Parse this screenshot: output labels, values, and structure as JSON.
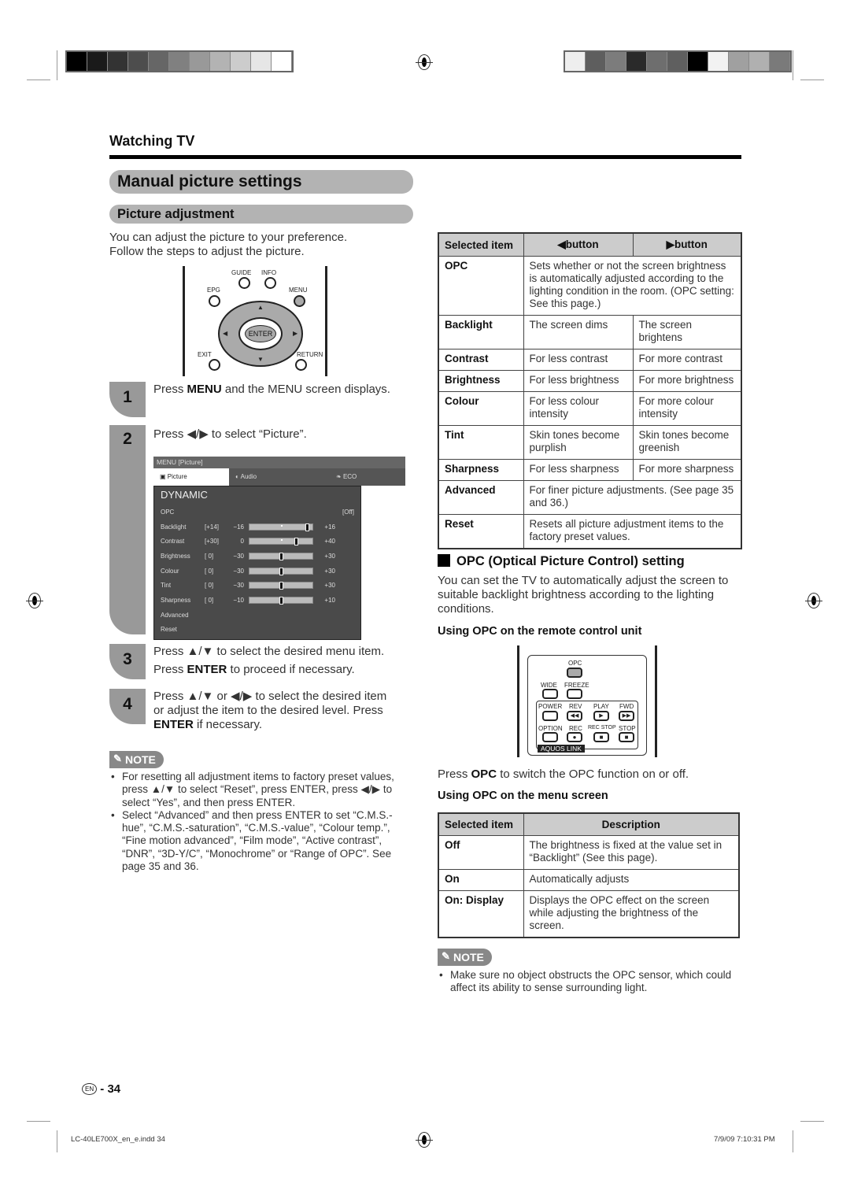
{
  "print_marks": {
    "left_swatches": [
      "#000000",
      "#1a1a1a",
      "#333333",
      "#4d4d4d",
      "#666666",
      "#808080",
      "#999999",
      "#b3b3b3",
      "#cccccc",
      "#e6e6e6",
      "#ffffff"
    ],
    "right_swatches": [
      "#eeeeee",
      "#5e5e5e",
      "#7c7c7c",
      "#2a2a2a",
      "#6e6e6e",
      "#5f5f5f",
      "#000000",
      "#f2f2f2",
      "#a0a0a0",
      "#b0b0b0",
      "#7a7a7a"
    ],
    "footer_file": "LC-40LE700X_en_e.indd   34",
    "footer_timestamp": "7/9/09   7:10:31 PM"
  },
  "header": {
    "section": "Watching TV"
  },
  "title": "Manual picture settings",
  "subsection": "Picture adjustment",
  "intro": [
    "You can adjust the picture to your preference.",
    "Follow the steps to adjust the picture."
  ],
  "remote_top": {
    "labels": {
      "guide": "GUIDE",
      "info": "INFO",
      "epg": "EPG",
      "menu": "MENU",
      "enter": "ENTER",
      "exit": "EXIT",
      "return": "RETURN"
    }
  },
  "steps": [
    {
      "num": "1",
      "pre": "Press ",
      "key": "MENU",
      "post": " and the MENU screen displays."
    },
    {
      "num": "2",
      "pre": "Press ◀/▶ to select “Picture”.",
      "key": "",
      "post": ""
    },
    {
      "num": "3",
      "line1": "Press ▲/▼ to select the desired menu item.",
      "line2_pre": "Press ",
      "line2_key": "ENTER",
      "line2_post": " to proceed if necessary."
    },
    {
      "num": "4",
      "line1": "Press ▲/▼ or ◀/▶ to select the desired item",
      "line2": "or adjust the item to the desired level. Press",
      "line3_key": "ENTER",
      "line3_post": " if necessary."
    }
  ],
  "menu_screen": {
    "breadcrumb": "MENU   [Picture]",
    "tabs": [
      {
        "label": "Picture",
        "icon": "picture-icon"
      },
      {
        "label": "Audio",
        "icon": "audio-icon"
      },
      {
        "label": "ECO",
        "icon": "eco-icon"
      }
    ],
    "mode": "DYNAMIC",
    "opc": {
      "label": "OPC",
      "value": "[Off]"
    },
    "sliders": [
      {
        "label": "Backlight",
        "current": "[+14]",
        "min": "−16",
        "max": "+16",
        "fraction": 0.94
      },
      {
        "label": "Contrast",
        "current": "[+30]",
        "min": "0",
        "max": "+40",
        "fraction": 0.75
      },
      {
        "label": "Brightness",
        "current": "[   0]",
        "min": "−30",
        "max": "+30",
        "fraction": 0.5
      },
      {
        "label": "Colour",
        "current": "[   0]",
        "min": "−30",
        "max": "+30",
        "fraction": 0.5
      },
      {
        "label": "Tint",
        "current": "[   0]",
        "min": "−30",
        "max": "+30",
        "fraction": 0.5
      },
      {
        "label": "Sharpness",
        "current": "[   0]",
        "min": "−10",
        "max": "+10",
        "fraction": 0.5
      }
    ],
    "extra_items": [
      "Advanced",
      "Reset"
    ]
  },
  "note1": {
    "label": "NOTE",
    "items": [
      "For resetting all adjustment items to factory preset values, press ▲/▼ to select “Reset”, press ENTER, press ◀/▶ to select “Yes”, and then press ENTER.",
      "Select “Advanced” and then press ENTER to set “C.M.S.-hue”, “C.M.S.-saturation”, “C.M.S.-value”, “Colour temp.”, “Fine motion advanced”, “Film mode”, “Active contrast”, “DNR”, “3D-Y/C”, “Monochrome” or “Range of OPC”. See page 35 and 36."
    ]
  },
  "adjust_table": {
    "headers": [
      "Selected item",
      "◀button",
      "▶button"
    ],
    "rows": [
      {
        "item": "OPC",
        "span": "Sets whether or not the screen brightness is automatically adjusted according to the lighting condition in the room. (OPC setting: See this page.)"
      },
      {
        "item": "Backlight",
        "left": "The screen dims",
        "right": "The screen brightens"
      },
      {
        "item": "Contrast",
        "left": "For less contrast",
        "right": "For more contrast"
      },
      {
        "item": "Brightness",
        "left": "For less brightness",
        "right": "For more brightness"
      },
      {
        "item": "Colour",
        "left": "For less colour intensity",
        "right": "For more colour intensity"
      },
      {
        "item": "Tint",
        "left": "Skin tones become purplish",
        "right": "Skin tones become greenish"
      },
      {
        "item": "Sharpness",
        "left": "For less sharpness",
        "right": "For more sharpness"
      },
      {
        "item": "Advanced",
        "span": "For finer picture adjustments. (See page 35 and 36.)"
      },
      {
        "item": "Reset",
        "span": "Resets all picture adjustment items to the factory preset values."
      }
    ]
  },
  "opc_section": {
    "title": "OPC (Optical Picture Control) setting",
    "intro": "You can set the TV to automatically adjust the screen to suitable backlight brightness according to the lighting conditions.",
    "remote_heading": "Using OPC on the remote control unit",
    "remote_labels": {
      "opc": "OPC",
      "wide": "WIDE",
      "freeze": "FREEZE",
      "power": "POWER",
      "rev": "REV",
      "play": "PLAY",
      "fwd": "FWD",
      "option": "OPTION",
      "rec": "REC",
      "recstop": "REC STOP",
      "stop": "STOP",
      "aquos": "AQUOS LINK"
    },
    "press_pre": "Press ",
    "press_key": "OPC",
    "press_post": " to switch the OPC function on or off.",
    "menu_heading": "Using OPC on the menu screen",
    "table": {
      "headers": [
        "Selected item",
        "Description"
      ],
      "rows": [
        {
          "item": "Off",
          "desc": "The brightness is fixed at the value set in “Backlight” (See this page)."
        },
        {
          "item": "On",
          "desc": "Automatically adjusts"
        },
        {
          "item": "On: Display",
          "desc": "Displays the OPC effect on the screen while adjusting the brightness of the screen."
        }
      ]
    }
  },
  "note2": {
    "label": "NOTE",
    "items": [
      "Make sure no object obstructs the OPC sensor, which could affect its ability to sense surrounding light."
    ]
  },
  "page": {
    "lang": "EN",
    "number": "- 34"
  }
}
